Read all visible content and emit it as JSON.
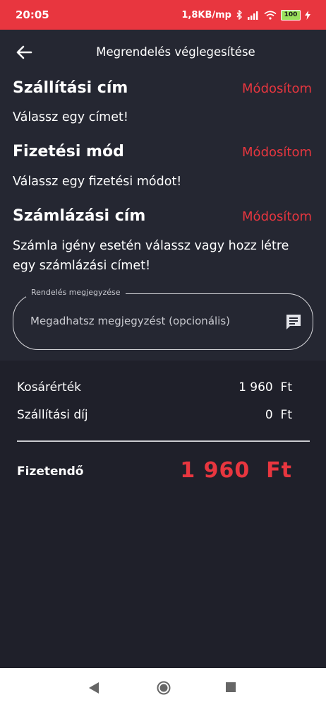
{
  "status_bar": {
    "time": "20:05",
    "network_speed": "1,8KB/mp",
    "battery_level": "100",
    "icons": [
      "bluetooth-icon",
      "signal-icon",
      "wifi-icon",
      "battery-icon",
      "charging-icon"
    ]
  },
  "header": {
    "title": "Megrendelés véglegesítése",
    "back_icon": "arrow-left-icon"
  },
  "sections": {
    "shipping": {
      "title": "Szállítási cím",
      "action": "Módosítom",
      "text": "Válassz egy címet!"
    },
    "payment": {
      "title": "Fizetési mód",
      "action": "Módosítom",
      "text": "Válassz egy fizetési módot!"
    },
    "billing": {
      "title": "Számlázási cím",
      "action": "Módosítom",
      "text": "Számla igény esetén válassz vagy hozz létre egy számlázási címet!"
    }
  },
  "note": {
    "label": "Rendelés megjegyzése",
    "placeholder": "Megadhatsz megjegyzést (opcionális)",
    "value": "",
    "icon": "message-icon"
  },
  "summary": {
    "cart_label": "Kosárérték",
    "cart_value": "1 960  Ft",
    "shipping_label": "Szállítási díj",
    "shipping_value": "0  Ft",
    "total_label": "Fizetendő",
    "total_value": "1 960  Ft"
  },
  "colors": {
    "accent": "#e8363f",
    "background": "#1f202a",
    "panel": "#252732",
    "text": "#ffffff"
  },
  "nav_bar": {
    "icons": [
      "nav-back-icon",
      "nav-home-icon",
      "nav-recents-icon"
    ]
  }
}
